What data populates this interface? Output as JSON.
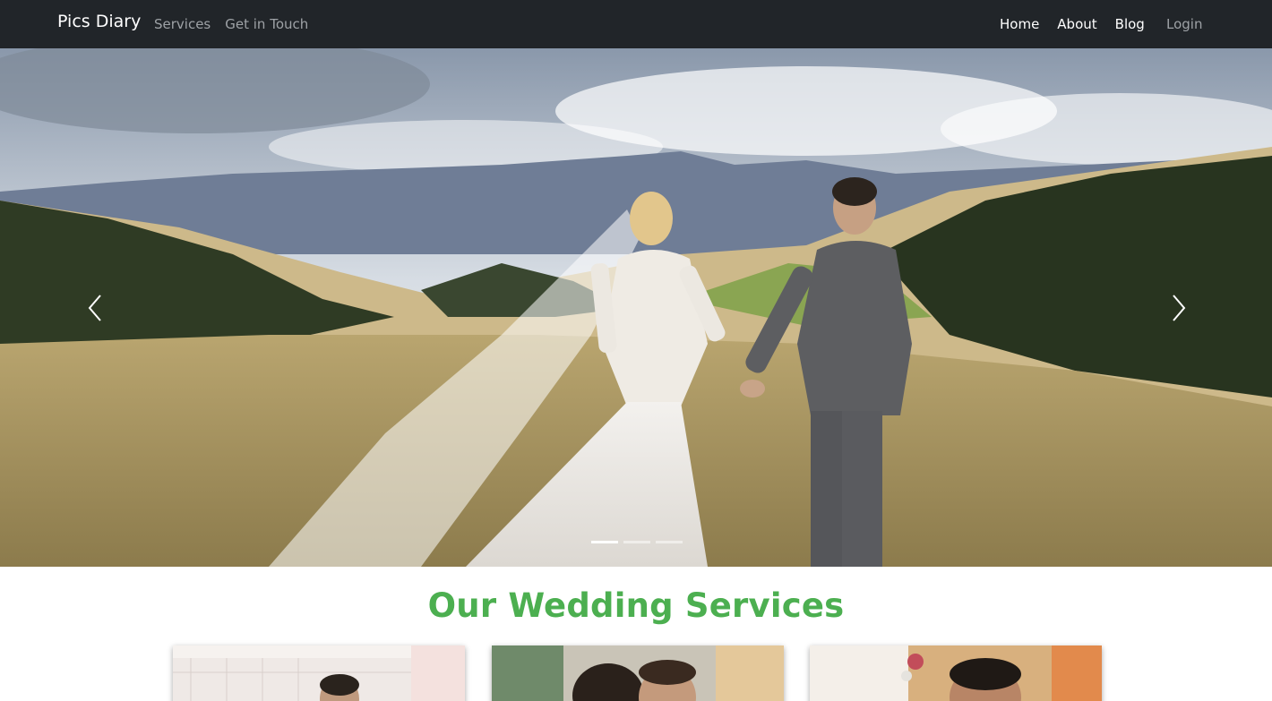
{
  "navbar": {
    "brand": "Pics Diary",
    "left_links": [
      "Services",
      "Get in Touch"
    ],
    "right_links": [
      "Home",
      "About",
      "Blog"
    ],
    "login": "Login"
  },
  "carousel": {
    "prev_label": "Previous",
    "next_label": "Next",
    "slide_count": 3,
    "active_slide": 1
  },
  "services": {
    "title": "Our Wedding Services"
  },
  "colors": {
    "navbar_bg": "#212529",
    "accent_green": "#4caf50"
  }
}
